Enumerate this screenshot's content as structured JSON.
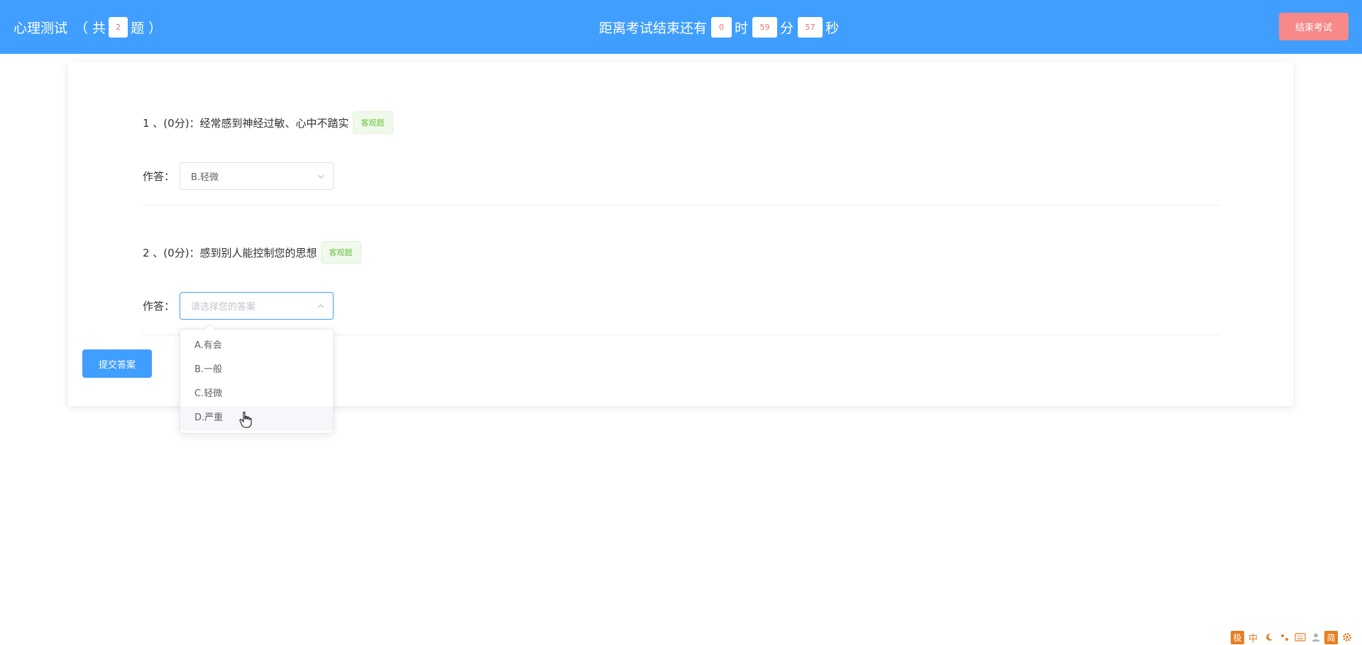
{
  "header": {
    "title": "心理测试",
    "count_prefix": "（ 共",
    "count": "2",
    "count_suffix": "题 ）",
    "timer_label": "距离考试结束还有",
    "hours": "0",
    "hours_unit": "时",
    "minutes": "59",
    "minutes_unit": "分",
    "seconds": "57",
    "seconds_unit": "秒",
    "end_button": "结束考试"
  },
  "questions": [
    {
      "title": "1 、(0分)：经常感到神经过敏、心中不踏实",
      "tag": "客观题",
      "answer_label": "作答：",
      "value": "B.轻微"
    },
    {
      "title": "2 、(0分)：感到别人能控制您的思想",
      "tag": "客观题",
      "answer_label": "作答：",
      "placeholder": "请选择您的答案"
    }
  ],
  "dropdown": {
    "options": [
      "A.有会",
      "B.一般",
      "C.轻微",
      "D.严重"
    ],
    "hovered_index": 3
  },
  "submit_button": "提交答案",
  "ime_toolbar": {
    "items": [
      "极",
      "中",
      "moon-icon",
      "punctuation-icon",
      "keyboard-icon",
      "user-icon",
      "简",
      "gear-icon"
    ]
  },
  "colors": {
    "header_bg": "#409eff",
    "danger": "#f56c6c",
    "end_button_bg": "#f78989",
    "tag_green": "#67c23a",
    "ime_orange": "#e67e22"
  }
}
